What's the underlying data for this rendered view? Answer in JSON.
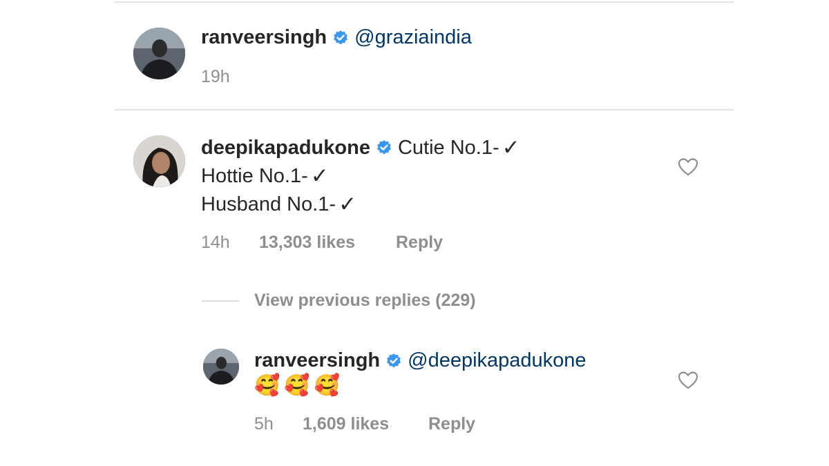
{
  "comment1": {
    "username": "ranveersingh",
    "mention": "@graziaindia",
    "time": "19h"
  },
  "comment2": {
    "username": "deepikapadukone",
    "line1": "Cutie No.1-",
    "line2": "Hottie No.1-",
    "line3": "Husband No.1-",
    "check": "✓",
    "time": "14h",
    "likes": "13,303 likes",
    "reply": "Reply"
  },
  "view_replies": "View previous replies (229)",
  "reply1": {
    "username": "ranveersingh",
    "mention": "@deepikapadukone",
    "emojis": [
      "🥰",
      "🥰",
      "🥰"
    ],
    "time": "5h",
    "likes": "1,609 likes",
    "reply": "Reply"
  },
  "colors": {
    "verified": "#3897f0",
    "mention": "#00376b",
    "meta": "#8e8e8e"
  },
  "icons": {
    "verified": "verified-badge-icon",
    "heart": "heart-outline-icon"
  }
}
